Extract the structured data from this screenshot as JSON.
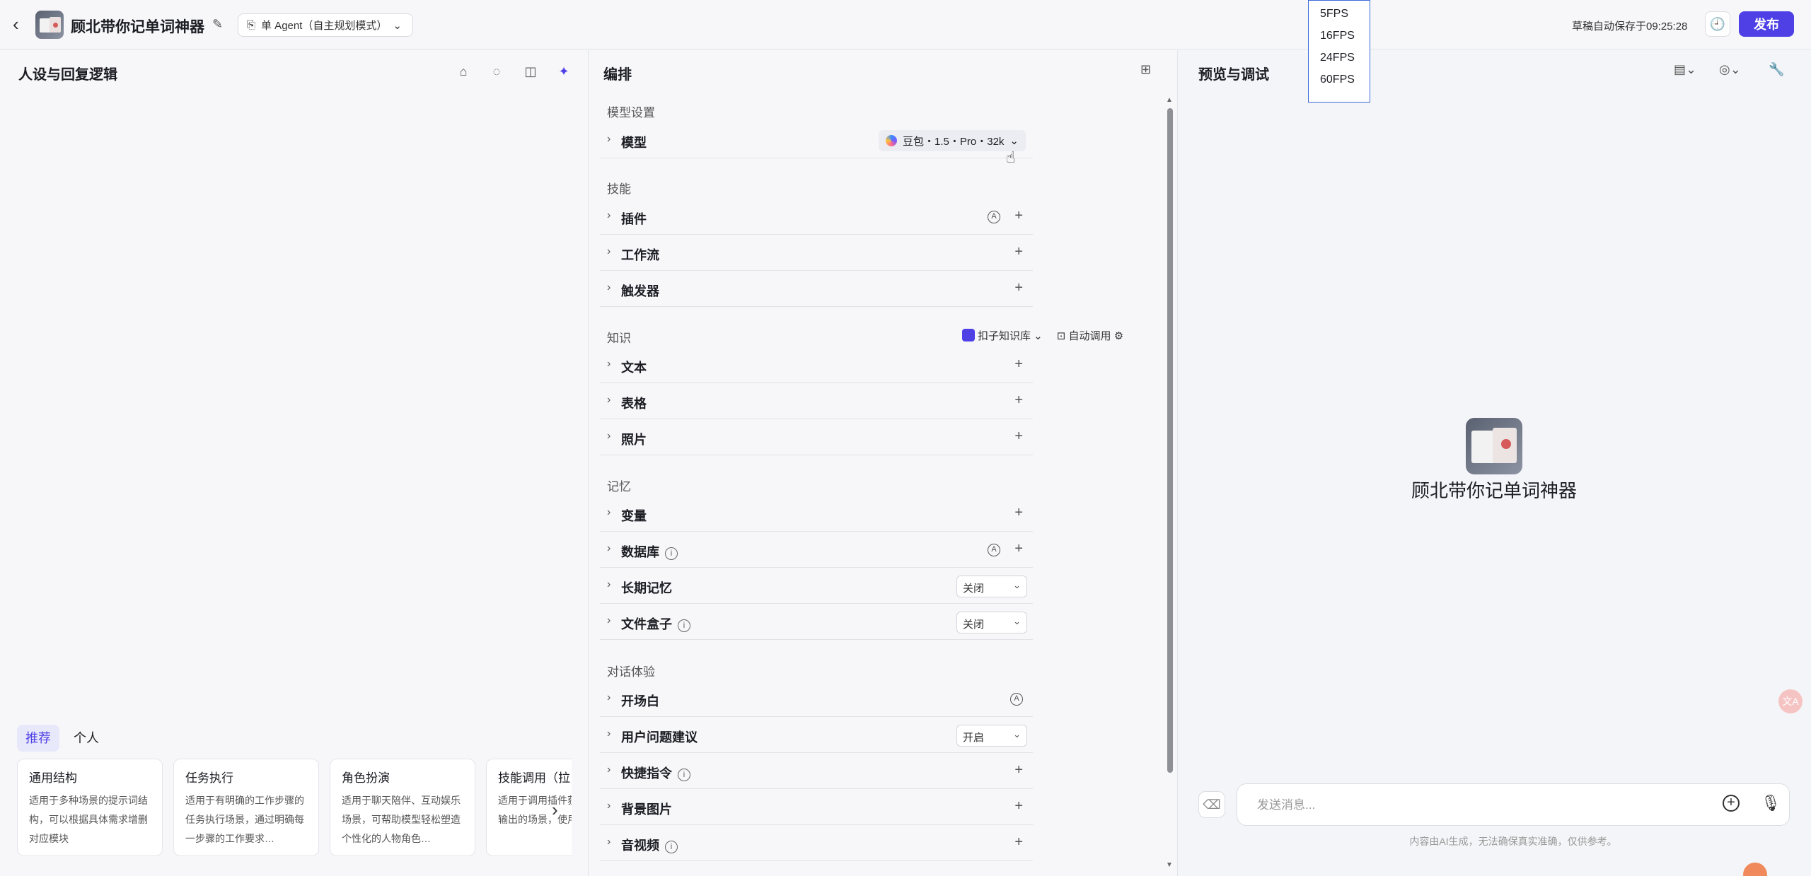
{
  "header": {
    "back_glyph": "‹",
    "bot_title": "顾北带你记单词神器",
    "mode_label": "单 Agent（自主规划模式）",
    "autosave": "草稿自动保存于09:25:28",
    "publish_label": "发布"
  },
  "fps_menu": [
    "5FPS",
    "16FPS",
    "24FPS",
    "60FPS"
  ],
  "left": {
    "title": "人设与回复逻辑",
    "tabs": [
      "推荐",
      "个人"
    ],
    "cards": [
      {
        "title": "通用结构",
        "desc": "适用于多种场景的提示词结构，可以根据具体需求增删对应模块"
      },
      {
        "title": "任务执行",
        "desc": "适用于有明确的工作步骤的任务执行场景，通过明确每一步骤的工作要求…"
      },
      {
        "title": "角色扮演",
        "desc": "适用于聊天陪伴、互动娱乐场景，可帮助模型轻松塑造个性化的人物角色…"
      },
      {
        "title": "技能调用（拉",
        "desc": "适用于调用插件获取信息并输出的场景，使用时"
      }
    ]
  },
  "middle": {
    "title": "编排",
    "sections": {
      "model": "模型设置",
      "skills": "技能",
      "knowledge": "知识",
      "memory": "记忆",
      "dialog": "对话体验"
    },
    "model_row": {
      "label": "模型",
      "value": "豆包・1.5・Pro・32k"
    },
    "skills_rows": [
      "插件",
      "工作流",
      "触发器"
    ],
    "knowledge_opts": {
      "kb": "扣子知识库",
      "auto": "自动调用"
    },
    "knowledge_rows": [
      "文本",
      "表格",
      "照片"
    ],
    "memory_rows": [
      "变量",
      "数据库",
      "长期记忆",
      "文件盒子"
    ],
    "dialog_rows": [
      "开场白",
      "用户问题建议",
      "快捷指令",
      "背景图片",
      "音视频"
    ],
    "select_off": "关闭",
    "select_on": "开启"
  },
  "right": {
    "title": "预览与调试",
    "bot_name": "顾北带你记单词神器",
    "input_placeholder": "发送消息...",
    "disclaimer": "内容由AI生成，无法确保真实准确，仅供参考。"
  }
}
